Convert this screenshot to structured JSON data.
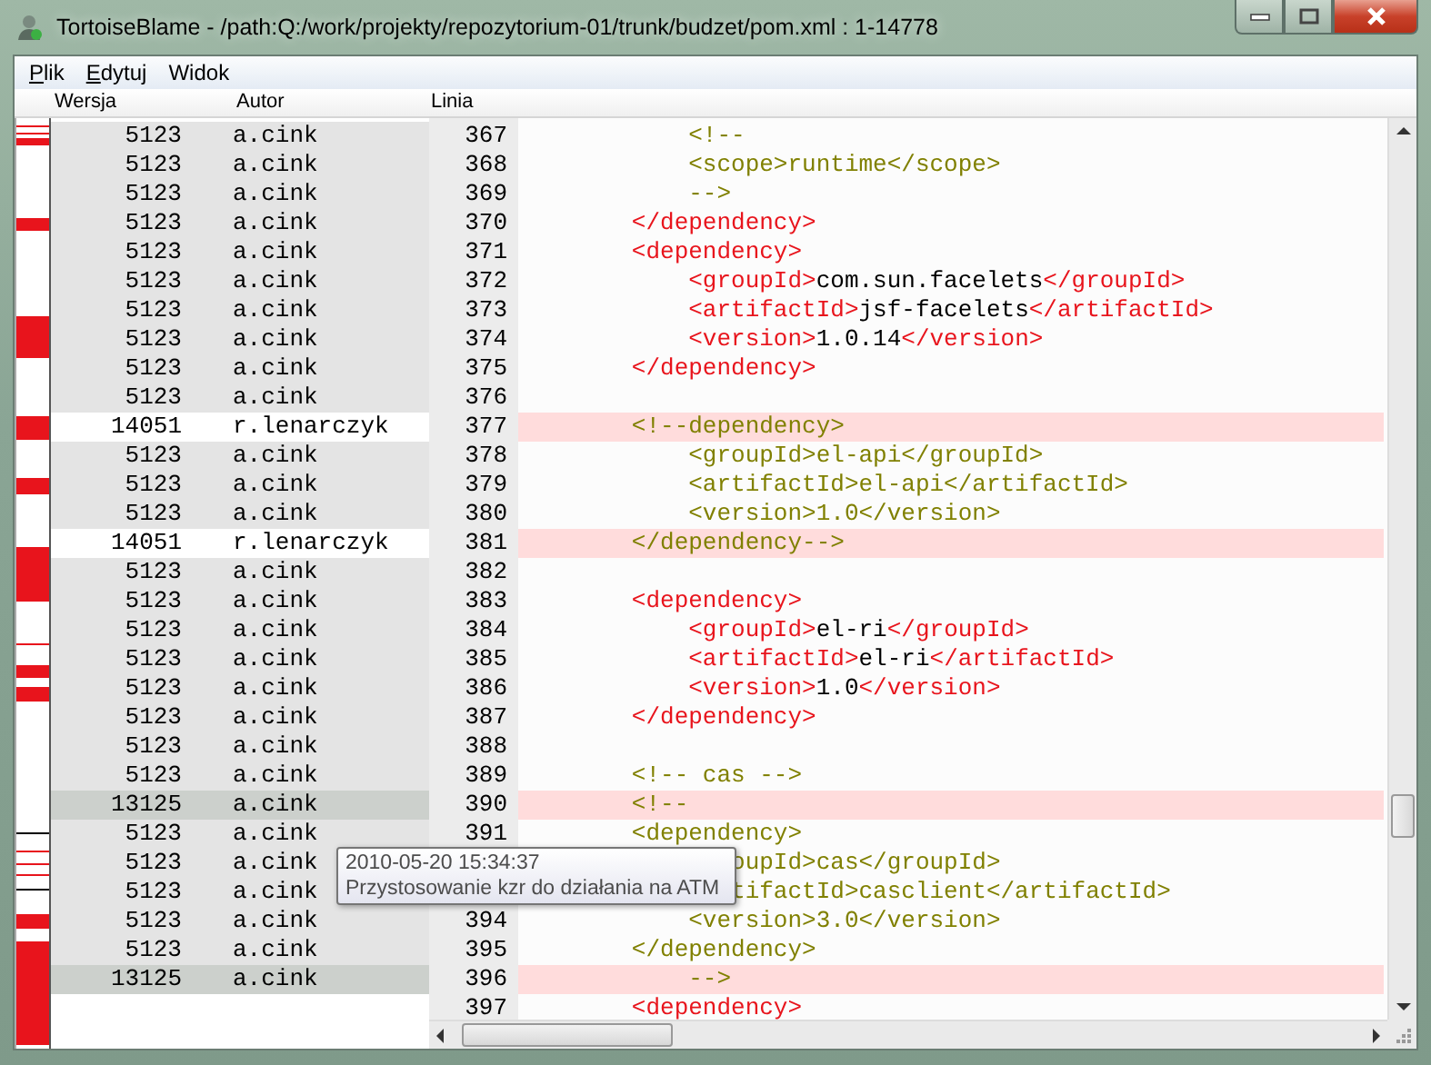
{
  "window": {
    "title": "TortoiseBlame - /path:Q:/work/projekty/repozytorium-01/trunk/budzet/pom.xml : 1-14778"
  },
  "menu": [
    {
      "label": "Plik",
      "mnemonic": true
    },
    {
      "label": "Edytuj",
      "mnemonic": true
    },
    {
      "label": "Widok",
      "mnemonic": false
    }
  ],
  "columns": [
    "Wersja",
    "Autor",
    "Linia"
  ],
  "rows": [
    {
      "version": "5123",
      "author": "a.cink",
      "line": "367",
      "color": "#e4e4e4",
      "highlighted": false,
      "code": [
        {
          "kind": "comment",
          "text": "            <!--"
        }
      ]
    },
    {
      "version": "5123",
      "author": "a.cink",
      "line": "368",
      "color": "#e4e4e4",
      "highlighted": false,
      "code": [
        {
          "kind": "comment",
          "text": "            <scope>runtime</scope>"
        }
      ]
    },
    {
      "version": "5123",
      "author": "a.cink",
      "line": "369",
      "color": "#e4e4e4",
      "highlighted": false,
      "code": [
        {
          "kind": "comment",
          "text": "            -->"
        }
      ]
    },
    {
      "version": "5123",
      "author": "a.cink",
      "line": "370",
      "color": "#e4e4e4",
      "highlighted": false,
      "code": [
        {
          "kind": "tag",
          "text": "        </dependency>"
        }
      ]
    },
    {
      "version": "5123",
      "author": "a.cink",
      "line": "371",
      "color": "#e4e4e4",
      "highlighted": false,
      "code": [
        {
          "kind": "tag",
          "text": "        <dependency>"
        }
      ]
    },
    {
      "version": "5123",
      "author": "a.cink",
      "line": "372",
      "color": "#e4e4e4",
      "highlighted": false,
      "code": [
        {
          "kind": "tag",
          "text": "            <groupId>"
        },
        {
          "kind": "text",
          "text": "com.sun.facelets"
        },
        {
          "kind": "tag",
          "text": "</groupId>"
        }
      ]
    },
    {
      "version": "5123",
      "author": "a.cink",
      "line": "373",
      "color": "#e4e4e4",
      "highlighted": false,
      "code": [
        {
          "kind": "tag",
          "text": "            <artifactId>"
        },
        {
          "kind": "text",
          "text": "jsf-facelets"
        },
        {
          "kind": "tag",
          "text": "</artifactId>"
        }
      ]
    },
    {
      "version": "5123",
      "author": "a.cink",
      "line": "374",
      "color": "#e4e4e4",
      "highlighted": false,
      "code": [
        {
          "kind": "tag",
          "text": "            <version>"
        },
        {
          "kind": "text",
          "text": "1.0.14"
        },
        {
          "kind": "tag",
          "text": "</version>"
        }
      ]
    },
    {
      "version": "5123",
      "author": "a.cink",
      "line": "375",
      "color": "#e4e4e4",
      "highlighted": false,
      "code": [
        {
          "kind": "tag",
          "text": "        </dependency>"
        }
      ]
    },
    {
      "version": "5123",
      "author": "a.cink",
      "line": "376",
      "color": "#e4e4e4",
      "highlighted": false,
      "code": []
    },
    {
      "version": "14051",
      "author": "r.lenarczyk",
      "line": "377",
      "color": "#ffffff",
      "highlighted": true,
      "code": [
        {
          "kind": "comment",
          "text": "        <!--dependency>"
        }
      ]
    },
    {
      "version": "5123",
      "author": "a.cink",
      "line": "378",
      "color": "#e4e4e4",
      "highlighted": false,
      "code": [
        {
          "kind": "comment",
          "text": "            <groupId>el-api</groupId>"
        }
      ]
    },
    {
      "version": "5123",
      "author": "a.cink",
      "line": "379",
      "color": "#e4e4e4",
      "highlighted": false,
      "code": [
        {
          "kind": "comment",
          "text": "            <artifactId>el-api</artifactId>"
        }
      ]
    },
    {
      "version": "5123",
      "author": "a.cink",
      "line": "380",
      "color": "#e4e4e4",
      "highlighted": false,
      "code": [
        {
          "kind": "comment",
          "text": "            <version>1.0</version>"
        }
      ]
    },
    {
      "version": "14051",
      "author": "r.lenarczyk",
      "line": "381",
      "color": "#ffffff",
      "highlighted": true,
      "code": [
        {
          "kind": "comment",
          "text": "        </dependency-->"
        }
      ]
    },
    {
      "version": "5123",
      "author": "a.cink",
      "line": "382",
      "color": "#e4e4e4",
      "highlighted": false,
      "code": []
    },
    {
      "version": "5123",
      "author": "a.cink",
      "line": "383",
      "color": "#e4e4e4",
      "highlighted": false,
      "code": [
        {
          "kind": "tag",
          "text": "        <dependency>"
        }
      ]
    },
    {
      "version": "5123",
      "author": "a.cink",
      "line": "384",
      "color": "#e4e4e4",
      "highlighted": false,
      "code": [
        {
          "kind": "tag",
          "text": "            <groupId>"
        },
        {
          "kind": "text",
          "text": "el-ri"
        },
        {
          "kind": "tag",
          "text": "</groupId>"
        }
      ]
    },
    {
      "version": "5123",
      "author": "a.cink",
      "line": "385",
      "color": "#e4e4e4",
      "highlighted": false,
      "code": [
        {
          "kind": "tag",
          "text": "            <artifactId>"
        },
        {
          "kind": "text",
          "text": "el-ri"
        },
        {
          "kind": "tag",
          "text": "</artifactId>"
        }
      ]
    },
    {
      "version": "5123",
      "author": "a.cink",
      "line": "386",
      "color": "#e4e4e4",
      "highlighted": false,
      "code": [
        {
          "kind": "tag",
          "text": "            <version>"
        },
        {
          "kind": "text",
          "text": "1.0"
        },
        {
          "kind": "tag",
          "text": "</version>"
        }
      ]
    },
    {
      "version": "5123",
      "author": "a.cink",
      "line": "387",
      "color": "#e4e4e4",
      "highlighted": false,
      "code": [
        {
          "kind": "tag",
          "text": "        </dependency>"
        }
      ]
    },
    {
      "version": "5123",
      "author": "a.cink",
      "line": "388",
      "color": "#e4e4e4",
      "highlighted": false,
      "code": []
    },
    {
      "version": "5123",
      "author": "a.cink",
      "line": "389",
      "color": "#e4e4e4",
      "highlighted": false,
      "code": [
        {
          "kind": "comment",
          "text": "        <!-- cas -->"
        }
      ]
    },
    {
      "version": "13125",
      "author": "a.cink",
      "line": "390",
      "color": "#ccd0cc",
      "highlighted": true,
      "code": [
        {
          "kind": "comment",
          "text": "        <!--"
        }
      ]
    },
    {
      "version": "5123",
      "author": "a.cink",
      "line": "391",
      "color": "#e4e4e4",
      "highlighted": false,
      "code": [
        {
          "kind": "comment",
          "text": "        <dependency>"
        }
      ]
    },
    {
      "version": "5123",
      "author": "a.cink",
      "color": "#e4e4e4",
      "highlighted": false,
      "code": [
        {
          "kind": "comment",
          "text": "               oupId>cas</groupId>"
        }
      ]
    },
    {
      "version": "5123",
      "author": "a.cink",
      "color": "#e4e4e4",
      "highlighted": false,
      "code": [
        {
          "kind": "comment",
          "text": "               tifactId>casclient</artifactId>"
        }
      ]
    },
    {
      "version": "5123",
      "author": "a.cink",
      "line": "394",
      "color": "#e4e4e4",
      "highlighted": false,
      "code": [
        {
          "kind": "comment",
          "text": "            <version>3.0</version>"
        }
      ]
    },
    {
      "version": "5123",
      "author": "a.cink",
      "line": "395",
      "color": "#e4e4e4",
      "highlighted": false,
      "code": [
        {
          "kind": "comment",
          "text": "        </dependency>"
        }
      ]
    },
    {
      "version": "13125",
      "author": "a.cink",
      "line": "396",
      "color": "#ccd0cc",
      "highlighted": true,
      "code": [
        {
          "kind": "comment",
          "text": "            -->"
        }
      ]
    },
    {
      "line": "397",
      "highlighted": false,
      "code": [
        {
          "kind": "tag",
          "text": "        <dependency>"
        }
      ]
    }
  ],
  "tooltip": {
    "date": "2010-05-20 15:34:37",
    "message": "Przystosowanie kzr do działania na ATM"
  }
}
